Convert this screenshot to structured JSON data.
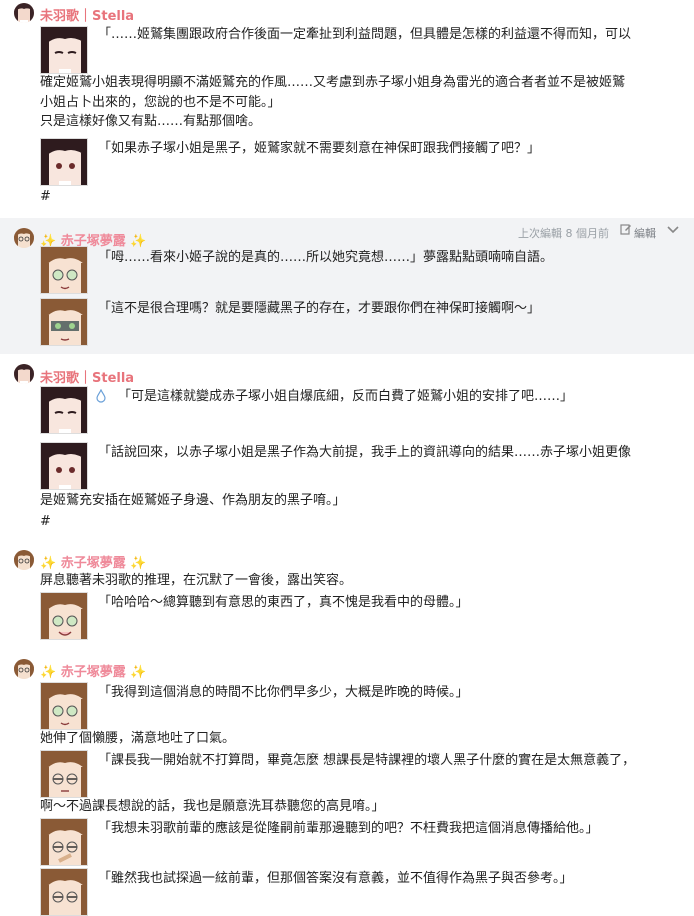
{
  "posts": {
    "p1": {
      "author": "未羽歌｜Stella",
      "l1": "「……姬鷲集團跟政府合作後面一定牽扯到利益問題，但具體是怎樣的利益還不得而知，可以",
      "l2": "確定姬鷲小姐表現得明顯不滿姬鷲充的作風……又考慮到赤子塚小姐身為雷光的適合者者並不是被姬鷲",
      "l3": "小姐占卜出來的，您說的也不是不可能。」",
      "l4": "只是這樣好像又有點……有點那個啥。",
      "l5": "「如果赤子塚小姐是黑子，姬鷲家就不需要刻意在神保町跟我們接觸了吧？」",
      "l6": "#"
    },
    "p2": {
      "author": "✨ 赤子塚夢露 ✨",
      "meta_edited": "上次編輯 8 個月前",
      "meta_edit": "編輯",
      "l1": "「呣……看來小姬子說的是真的……所以她究竟想……」夢露點點頭喃喃自語。",
      "l2": "「這不是很合理嗎？就是要隱藏黑子的存在，才要跟你們在神保町接觸啊～」"
    },
    "p3": {
      "author": "未羽歌｜Stella",
      "l1": "「可是這樣就變成赤子塚小姐自爆底細，反而白費了姬鷲小姐的安排了吧……」",
      "l2": "「話說回來，以赤子塚小姐是黑子作為大前提，我手上的資訊導向的結果……赤子塚小姐更像",
      "l3": "是姬鷲充安插在姬鷲姬子身邊、作為朋友的黑子唷。」",
      "l4": "#"
    },
    "p4": {
      "author": "✨ 赤子塚夢露 ✨",
      "l1": "屏息聽著未羽歌的推理，在沉默了一會後，露出笑容。",
      "l2": "「哈哈哈～總算聽到有意思的東西了，真不愧是我看中的母體。」"
    },
    "p5": {
      "author": "✨ 赤子塚夢露 ✨",
      "l1": "「我得到這個消息的時間不比你們早多少，大概是昨晚的時候。」",
      "l2": "她伸了個懶腰，滿意地吐了口氣。",
      "l3": "「課長我一開始就不打算問，畢竟怎麼 想課長是特課裡的壞人黑子什麼的實在是太無意義了，",
      "l4": "啊～不過課長想說的話，我也是願意洗耳恭聽您的高見唷。」",
      "l5": "「我想未羽歌前輩的應該是從隆嗣前輩那邊聽到的吧？不枉費我把這個消息傳播給他。」",
      "l6": "「雖然我也試探過一絃前輩，但那個答案沒有意義，並不值得作為黑子與否參考。」"
    }
  },
  "colors": {
    "stella_name": "#e8747c",
    "mel_name": "#ef8a9a",
    "highlight_bg": "#f2f3f5"
  },
  "icons": {
    "edit": "pencil-square-icon",
    "more": "chevron-down-icon",
    "drop": "water-drop-icon"
  }
}
